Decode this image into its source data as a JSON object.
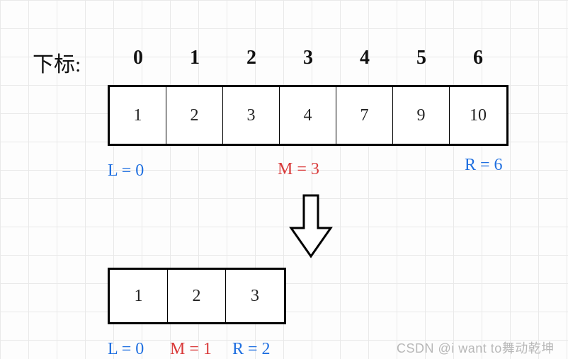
{
  "title": "下标:",
  "indices": [
    "0",
    "1",
    "2",
    "3",
    "4",
    "5",
    "6"
  ],
  "array1": [
    "1",
    "2",
    "3",
    "4",
    "7",
    "9",
    "10"
  ],
  "array2": [
    "1",
    "2",
    "3"
  ],
  "step1": {
    "L": "L = 0",
    "M": "M = 3",
    "R": "R = 6"
  },
  "step2": {
    "L": "L = 0",
    "M": "M = 1",
    "R": "R = 2"
  },
  "watermark": "CSDN @i want to舞动乾坤"
}
